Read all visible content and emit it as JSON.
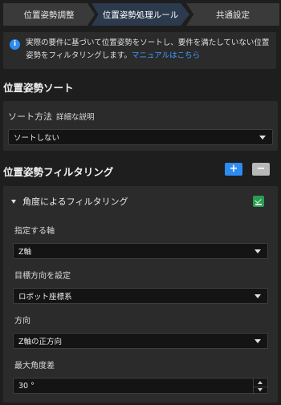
{
  "tabs": [
    {
      "label": "位置姿勢調整"
    },
    {
      "label": "位置姿勢処理ルール"
    },
    {
      "label": "共通設定"
    }
  ],
  "info": {
    "text": "実際の要件に基づいて位置姿勢をソートし、要件を満たしていない位置姿勢をフィルタリングします。",
    "link": "マニュアルはこちら"
  },
  "sort": {
    "title": "位置姿勢ソート",
    "method_label": "ソート方法",
    "detail_link": "詳細な説明",
    "method_value": "ソートしない"
  },
  "filter": {
    "title": "位置姿勢フィルタリング",
    "add_label": "+",
    "remove_label": "−",
    "group": {
      "title": "角度によるフィルタリング",
      "axis_label": "指定する軸",
      "axis_value": "Z軸",
      "target_label": "目標方向を設定",
      "target_value": "ロボット座標系",
      "direction_label": "方向",
      "direction_value": "Z軸の正方向",
      "max_angle_label": "最大角度差",
      "max_angle_value": "30 °"
    }
  },
  "icons": {
    "info": "info-icon",
    "caret": "chevron-down-icon",
    "collapse": "collapse-triangle-icon",
    "enabled": "enable-check-icon"
  },
  "colors": {
    "accent": "#2e8cf0",
    "link": "#3e9bff",
    "enabled": "#2a9d52"
  }
}
